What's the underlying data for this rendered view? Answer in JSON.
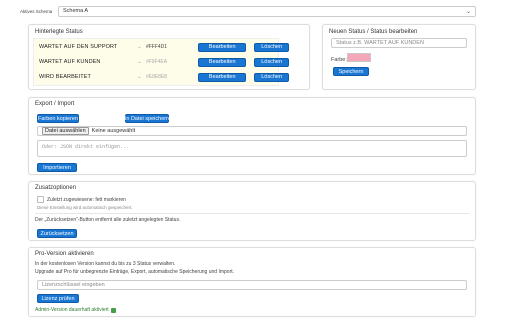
{
  "scheme": {
    "label": "Aktives Schema",
    "selected": "Schema A"
  },
  "statuses": {
    "title": "Hinterlegte Status",
    "edit_label": "Bearbeiten",
    "delete_label": "Löschen",
    "rows": [
      {
        "name": "WARTET AUF DEN SUPPORT",
        "arrow": "→",
        "color_code": "#FFF4D1"
      },
      {
        "name": "WARTET AUF KUNDEN",
        "arrow": "→",
        "color_code": "#F9F4EA"
      },
      {
        "name": "WIRD BEARBEITET",
        "arrow": "→",
        "color_code": "#E8E8E8"
      }
    ]
  },
  "edit_status": {
    "title": "Neuen Status / Status bearbeiten",
    "name_placeholder": "Status z.B. WARTET AUF KUNDEN",
    "color_label": "Farbe:",
    "color_value": "#f4a7b9",
    "save_label": "Speichern"
  },
  "export_import": {
    "title": "Export / Import",
    "copy_label": "Farben kopieren",
    "save_file_label": "In Datei speichern",
    "file_button_label": "Datei auswählen",
    "file_status": "Keine ausgewählt",
    "json_placeholder": "Oder: JSON direkt einfügen...",
    "import_label": "Importieren"
  },
  "options": {
    "title": "Zusatzoptionen",
    "checkbox_label": "Zuletzt zugewiesene: fett markieren",
    "checkbox_hint": "Diese Einstellung wird automatisch gespeichert.",
    "reset_note": "Der „Zurücksetzen“-Button entfernt alle zuletzt angelegten Status.",
    "reset_label": "Zurücksetzen"
  },
  "pro": {
    "title": "Pro-Version aktivieren",
    "line1": "In der kostenlosen Version kannst du bis zu 3 Status verwalten.",
    "line2": "Upgrade auf Pro für unbegrenzte Einträge, Export, automatische Speicherung und Import.",
    "license_placeholder": "Lizenzschlüssel eingeben",
    "check_label": "Lizenz prüfen",
    "activated_text": "Admin-Version dauerhaft aktiviert"
  }
}
